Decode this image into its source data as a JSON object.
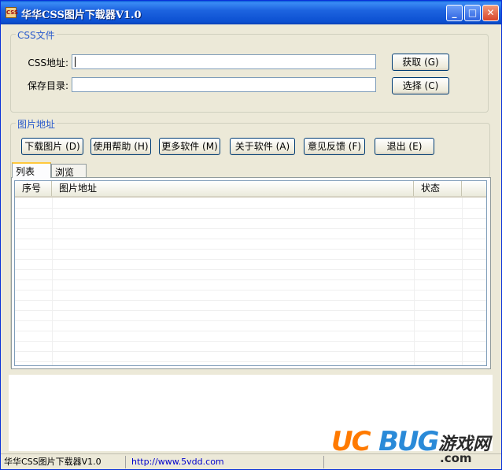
{
  "window": {
    "app_icon_text": "CSS",
    "title": "华华CSS图片下载器V1.0",
    "minimize_glyph": "_",
    "maximize_glyph": "□",
    "close_glyph": "✕"
  },
  "css_group": {
    "title": "CSS文件",
    "url_label": "CSS地址:",
    "url_value": "",
    "save_label": "保存目录:",
    "save_value": "",
    "fetch_button": "获取 (G)",
    "browse_button": "选择 (C)"
  },
  "image_group": {
    "title": "图片地址",
    "buttons": [
      "下载图片 (D)",
      "使用帮助 (H)",
      "更多软件 (M)",
      "关于软件 (A)",
      "意见反馈 (F)",
      "退出 (E)"
    ],
    "tabs": [
      "列表",
      "浏览"
    ],
    "columns": [
      "序号",
      "图片地址",
      "状态",
      ""
    ]
  },
  "statusbar": {
    "app_name": "华华CSS图片下载器V1.0",
    "url": "http://www.5vdd.com"
  },
  "watermark": {
    "brand_part1": "UC",
    "brand_part2": "BUG",
    "cn_text": "游戏网",
    "domain": ".com"
  },
  "colors": {
    "titlebar": "#0b4fd0",
    "group_title": "#2a5bcc",
    "status_link": "#0000cc",
    "watermark_orange": "#ff7a00",
    "watermark_blue": "#2a8ad8"
  }
}
